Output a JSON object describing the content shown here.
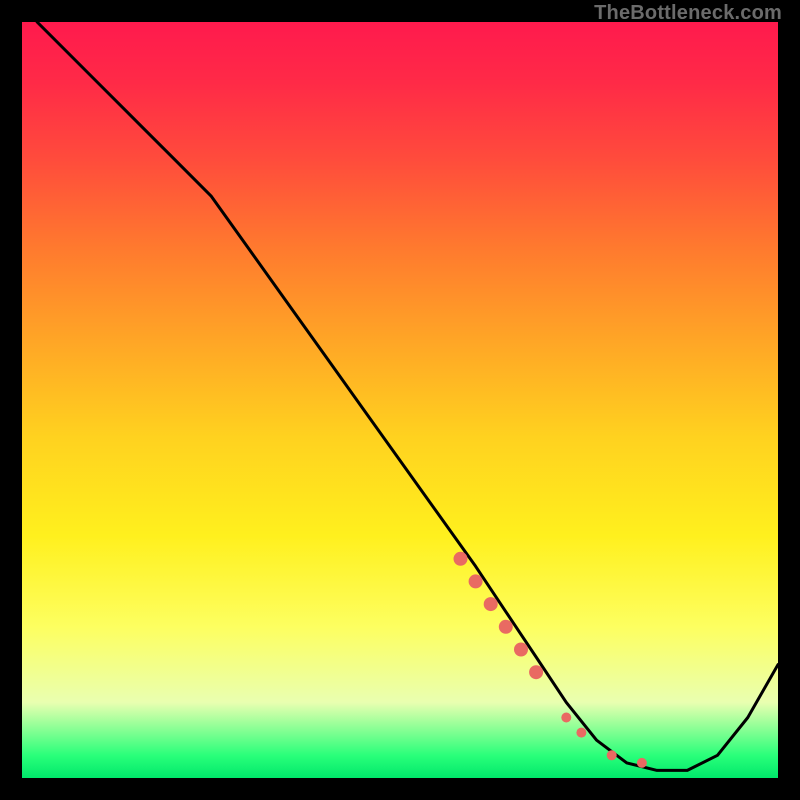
{
  "watermark": "TheBottleneck.com",
  "chart_data": {
    "type": "line",
    "title": "",
    "xlabel": "",
    "ylabel": "",
    "xlim": [
      0,
      100
    ],
    "ylim": [
      0,
      100
    ],
    "grid": false,
    "series": [
      {
        "name": "curve",
        "x": [
          2,
          10,
          20,
          25,
          30,
          35,
          40,
          45,
          50,
          55,
          60,
          64,
          68,
          72,
          76,
          80,
          84,
          88,
          92,
          96,
          100
        ],
        "y": [
          100,
          92,
          82,
          77,
          70,
          63,
          56,
          49,
          42,
          35,
          28,
          22,
          16,
          10,
          5,
          2,
          1,
          1,
          3,
          8,
          15
        ],
        "color": "#000000"
      }
    ],
    "highlight_points": {
      "name": "dots",
      "x": [
        58,
        60,
        62,
        64,
        66,
        68,
        72,
        74,
        78,
        82
      ],
      "y": [
        29,
        26,
        23,
        20,
        17,
        14,
        8,
        6,
        3,
        2
      ],
      "color": "#e96a62"
    }
  }
}
